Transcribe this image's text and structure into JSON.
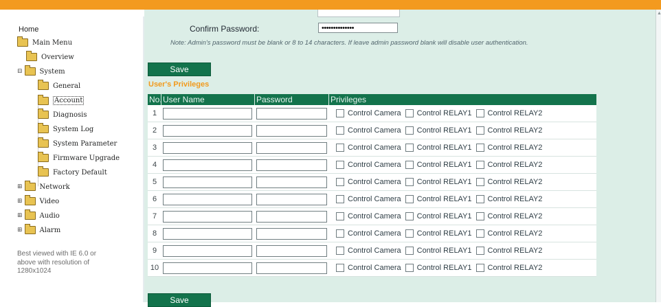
{
  "sidebar": {
    "home": "Home",
    "main_menu": "Main Menu",
    "overview": "Overview",
    "system": "System",
    "system_items": [
      "General",
      "Account",
      "Diagnosis",
      "System Log",
      "System Parameter",
      "Firmware Upgrade",
      "Factory Default"
    ],
    "network": "Network",
    "video": "Video",
    "audio": "Audio",
    "alarm": "Alarm",
    "note": "Best viewed with IE 6.0 or\nabove with resolution of\n1280x1024"
  },
  "admin": {
    "confirm_label": "Confirm Password:",
    "confirm_value": "••••••••••••••",
    "note": "Note: Admin's password must be blank or 8 to 14 characters. If leave admin password blank will disable user authentication.",
    "save": "Save"
  },
  "privileges": {
    "title": "User's Privileges",
    "columns": [
      "No.",
      "User Name",
      "Password",
      "Privileges"
    ],
    "options": [
      "Control Camera",
      "Control RELAY1",
      "Control RELAY2"
    ],
    "rows": [
      "1",
      "2",
      "3",
      "4",
      "5",
      "6",
      "7",
      "8",
      "9",
      "10"
    ],
    "save": "Save"
  },
  "colors": {
    "top_bar": "#f39a1f",
    "accent_green": "#13734c",
    "panel_bg": "#dceee7"
  }
}
